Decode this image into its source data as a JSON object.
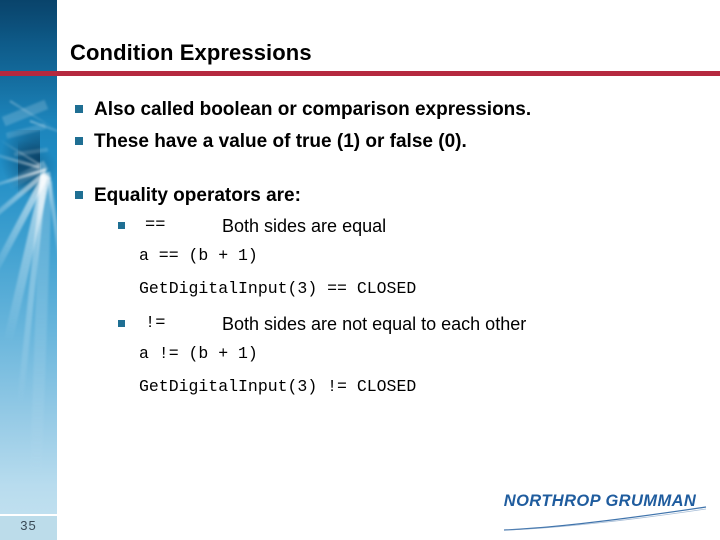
{
  "slide": {
    "title": "Condition Expressions",
    "page_number": "35",
    "accent_rule_color": "#b5293f",
    "bullet_color": "#1f6f93",
    "panel_color": "#1f8cc4",
    "logo_color": "#1f5c9e"
  },
  "bullets": [
    {
      "level": 1,
      "text": "Also called boolean or comparison expressions."
    },
    {
      "level": 1,
      "text": "These have a value of true (1) or false (0)."
    },
    {
      "level": 1,
      "text": "Equality operators are:"
    }
  ],
  "operators": [
    {
      "symbol": "==",
      "description": "Both sides are equal",
      "examples": [
        "a == (b + 1)",
        "GetDigitalInput(3) == CLOSED"
      ]
    },
    {
      "symbol": "!=",
      "description": "Both sides are not equal to each other",
      "examples": [
        "a != (b + 1)",
        "GetDigitalInput(3) != CLOSED"
      ]
    }
  ],
  "logo": {
    "name": "NORTHROP GRUMMAN"
  }
}
